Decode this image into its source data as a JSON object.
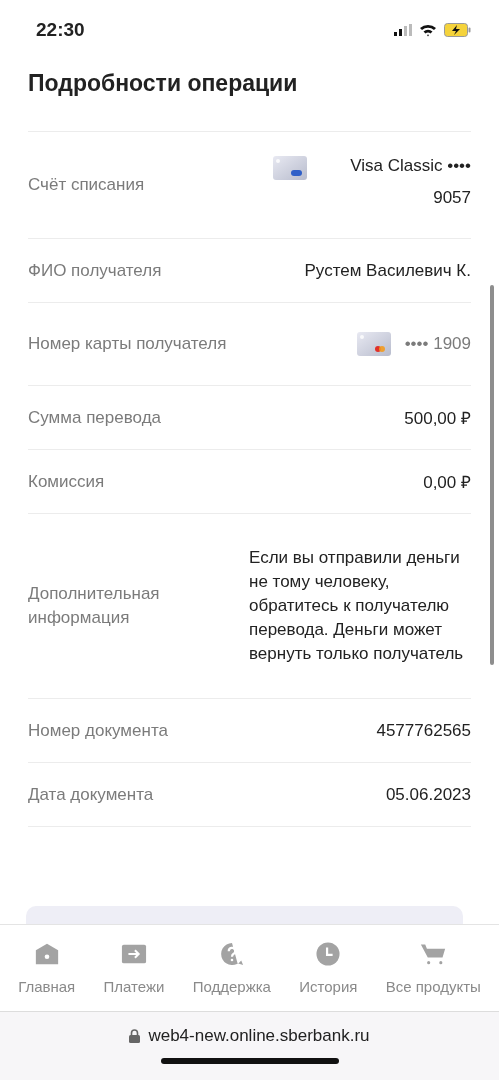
{
  "status_bar": {
    "time": "22:30"
  },
  "title": "Подробности операции",
  "rows": [
    {
      "kind": "account",
      "label": "Счёт списания",
      "value": "Visa Classic •••• 9057"
    },
    {
      "kind": "text",
      "label": "ФИО получателя",
      "value": "Рустем Василевич К."
    },
    {
      "kind": "card",
      "label": "Номер карты получателя",
      "value": "•••• 1909"
    },
    {
      "kind": "text",
      "label": "Сумма перевода",
      "value": "500,00 ₽"
    },
    {
      "kind": "text",
      "label": "Комиссия",
      "value": "0,00 ₽"
    },
    {
      "kind": "note",
      "label": "Дополнительная информация",
      "value": "Если вы отправили деньги не тому человеку, обратитесь к получателю перевода. Деньги может вернуть только получатель"
    },
    {
      "kind": "text",
      "label": "Номер документа",
      "value": "4577762565"
    },
    {
      "kind": "text",
      "label": "Дата документа",
      "value": "05.06.2023"
    }
  ],
  "nav": [
    {
      "label": "Главная"
    },
    {
      "label": "Платежи"
    },
    {
      "label": "Поддержка"
    },
    {
      "label": "История"
    },
    {
      "label": "Все продукты"
    }
  ],
  "browser": {
    "url": "web4-new.online.sberbank.ru"
  }
}
